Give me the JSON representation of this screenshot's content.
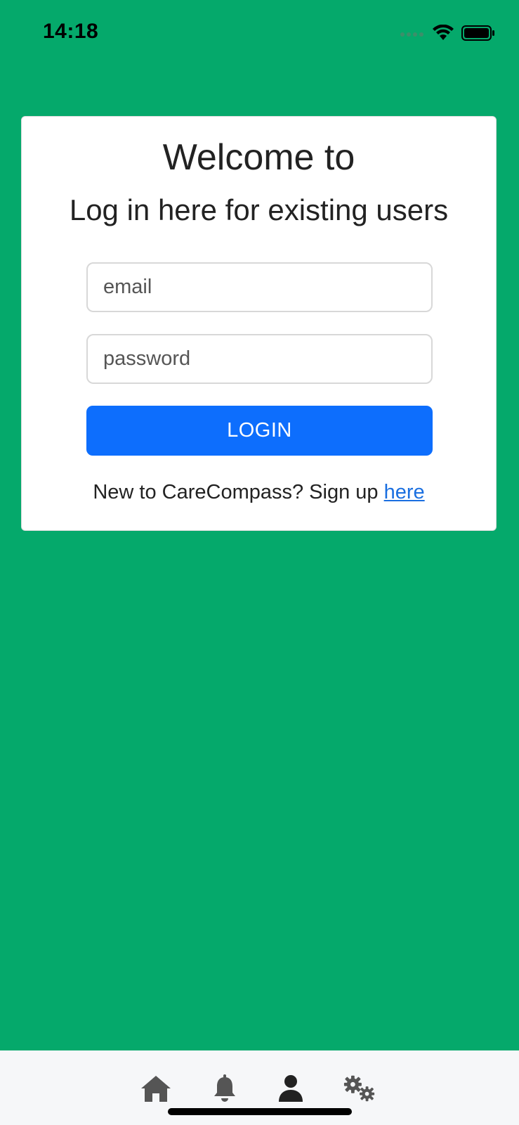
{
  "status_bar": {
    "time": "14:18"
  },
  "login_card": {
    "title": "Welcome to",
    "subtitle": "Log in here for existing users",
    "email_placeholder": "email",
    "password_placeholder": "password",
    "login_label": "LOGIN",
    "signup_prefix": "New to CareCompass? Sign up ",
    "signup_link": "here"
  },
  "tab_bar": {
    "items": [
      {
        "icon": "home-icon"
      },
      {
        "icon": "bell-icon"
      },
      {
        "icon": "user-icon",
        "active": true
      },
      {
        "icon": "gears-icon"
      }
    ]
  },
  "colors": {
    "background": "#05a96b",
    "primary_button": "#0d6efd",
    "link": "#1a6fe0",
    "tab_bar": "#f6f7f9"
  }
}
